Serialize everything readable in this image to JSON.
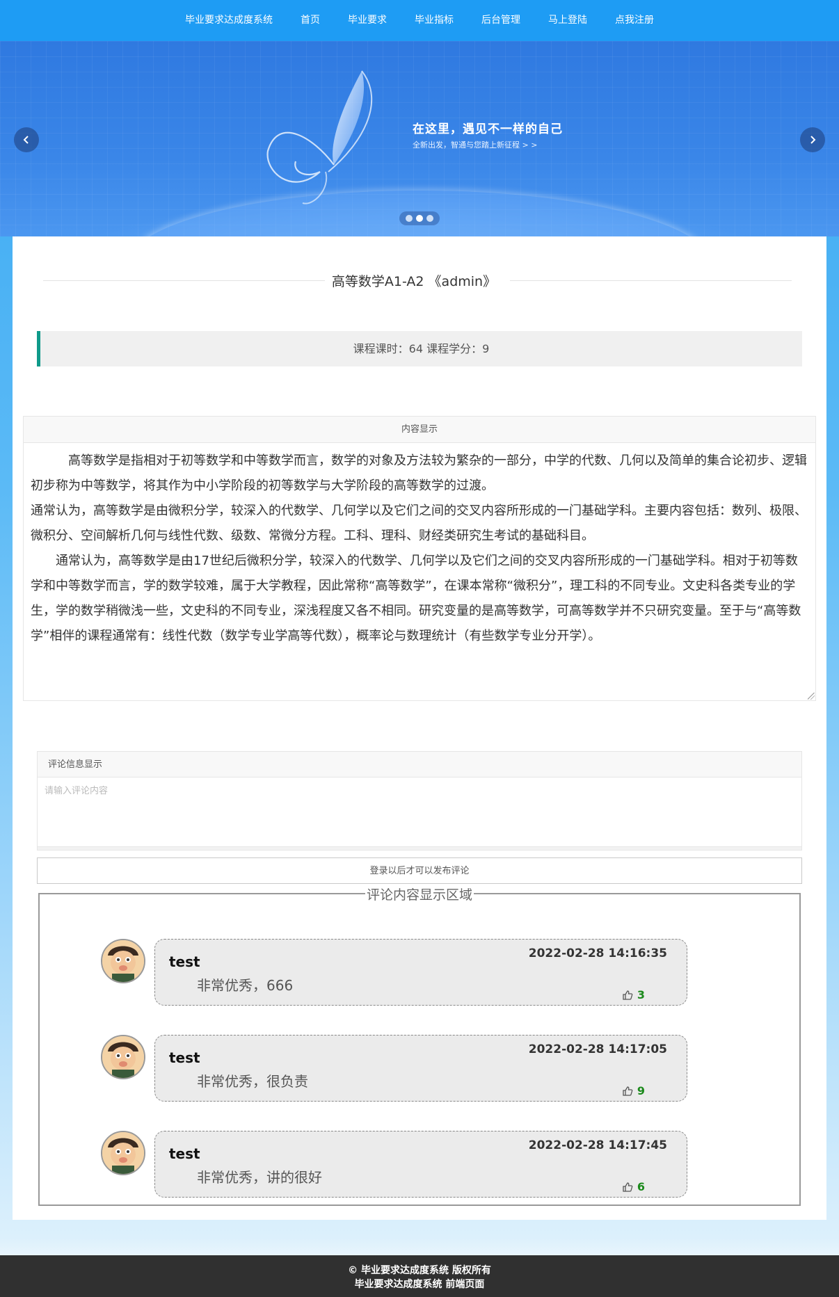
{
  "nav": {
    "items": [
      {
        "label": "毕业要求达成度系统"
      },
      {
        "label": "首页"
      },
      {
        "label": "毕业要求"
      },
      {
        "label": "毕业指标"
      },
      {
        "label": "后台管理"
      },
      {
        "label": "马上登陆"
      },
      {
        "label": "点我注册"
      }
    ]
  },
  "banner": {
    "title": "在这里，遇见不一样的自己",
    "subtitle": "全新出发，智通与您踏上新征程 > >",
    "slide_count": 3,
    "active_slide": 2
  },
  "course": {
    "title": "高等数学A1-A2 《admin》",
    "meta": "课程课时：64 课程学分：9"
  },
  "content": {
    "header": "内容显示",
    "paragraphs": [
      "　　　高等数学是指相对于初等数学和中等数学而言，数学的对象及方法较为繁杂的一部分，中学的代数、几何以及简单的集合论初步、逻辑初步称为中等数学，将其作为中小学阶段的初等数学与大学阶段的高等数学的过渡。",
      "通常认为，高等数学是由微积分学，较深入的代数学、几何学以及它们之间的交叉内容所形成的一门基础学科。主要内容包括：数列、极限、微积分、空间解析几何与线性代数、级数、常微分方程。工科、理科、财经类研究生考试的基础科目。",
      "　　通常认为，高等数学是由17世纪后微积分学，较深入的代数学、几何学以及它们之间的交叉内容所形成的一门基础学科。相对于初等数学和中等数学而言，学的数学较难，属于大学教程，因此常称“高等数学”，在课本常称“微积分”，理工科的不同专业。文史科各类专业的学生，学的数学稍微浅一些，文史科的不同专业，深浅程度又各不相同。研究变量的是高等数学，可高等数学并不只研究变量。至于与“高等数学”相伴的课程通常有：线性代数（数学专业学高等代数），概率论与数理统计（有些数学专业分开学）。"
    ]
  },
  "comment_form": {
    "header": "评论信息显示",
    "placeholder": "请输入评论内容",
    "login_button": "登录以后才可以发布评论"
  },
  "comments": {
    "legend": "评论内容显示区域",
    "items": [
      {
        "user": "test",
        "time": "2022-02-28 14:16:35",
        "text": "非常优秀，666",
        "likes": "3"
      },
      {
        "user": "test",
        "time": "2022-02-28 14:17:05",
        "text": "非常优秀，很负责",
        "likes": "9"
      },
      {
        "user": "test",
        "time": "2022-02-28 14:17:45",
        "text": "非常优秀，讲的很好",
        "likes": "6"
      }
    ]
  },
  "footer": {
    "line1": "© 毕业要求达成度系统 版权所有",
    "line2": "毕业要求达成度系统 前端页面"
  },
  "colors": {
    "nav_bg": "#1e9cf4",
    "accent_bar": "#0f9a8a",
    "like_count": "#1c8a1c",
    "footer_bg": "#303030"
  },
  "icons": [
    "chevron-left-icon",
    "chevron-right-icon",
    "butterfly-logo-icon",
    "thumbs-up-icon",
    "avatar-icon"
  ]
}
